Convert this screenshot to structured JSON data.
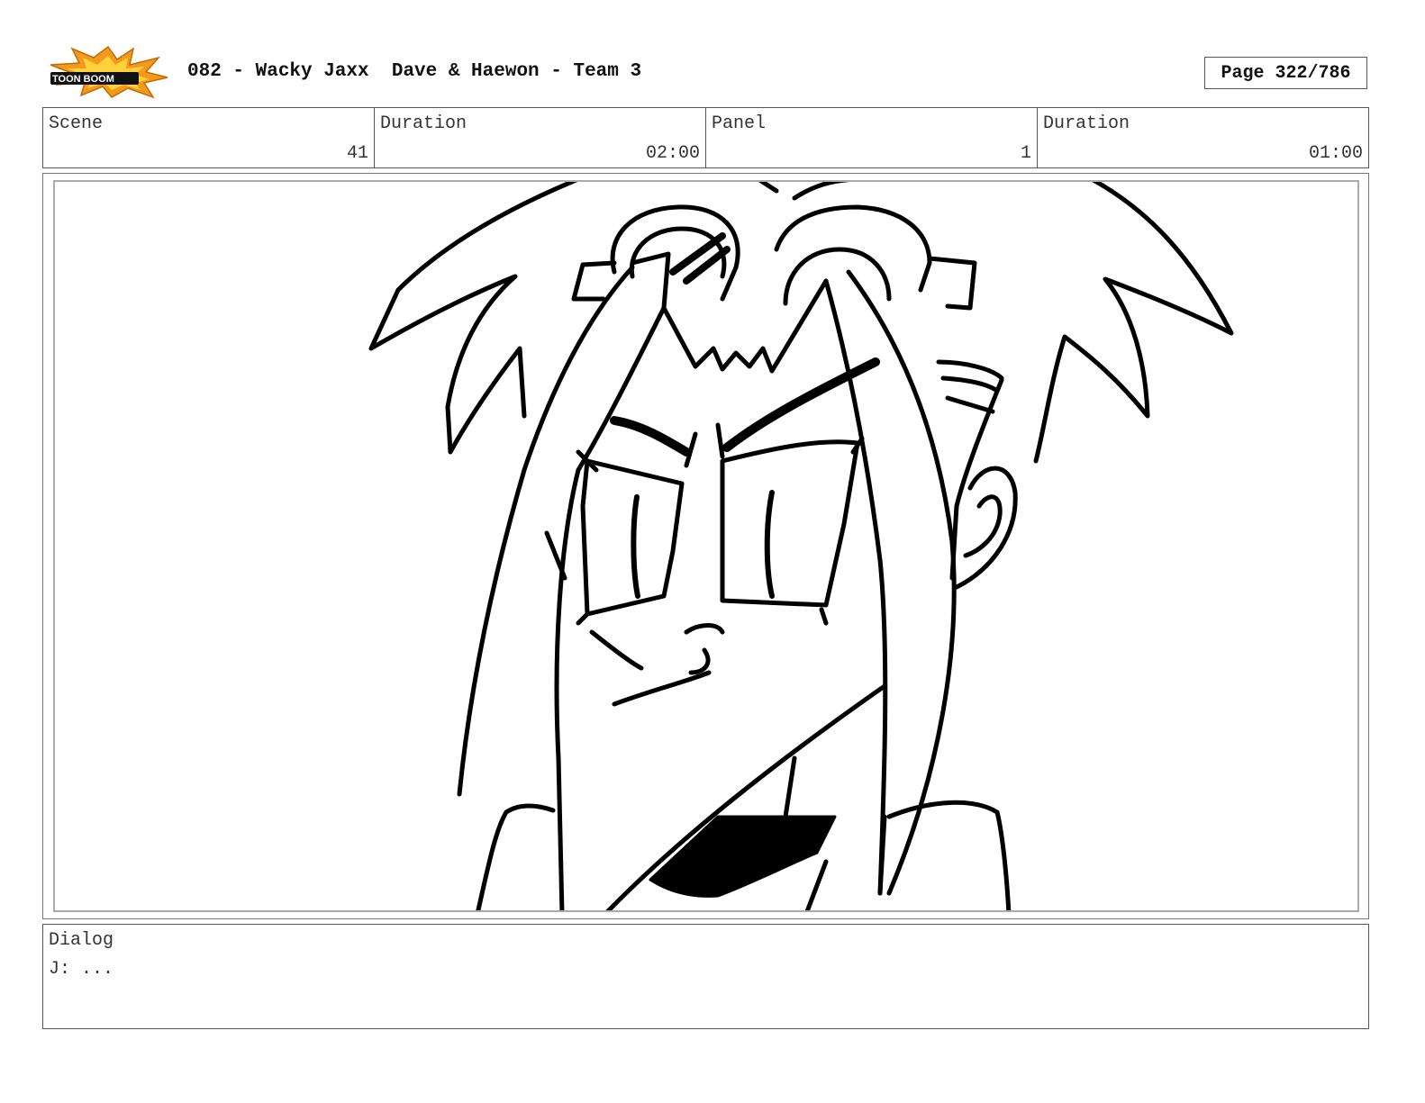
{
  "header": {
    "logo_text": "TOON BOOM",
    "title": "082 - Wacky Jaxx  Dave & Haewon - Team 3",
    "page": "Page 322/786"
  },
  "info": {
    "scene_label": "Scene",
    "scene_value": "41",
    "duration_label": "Duration",
    "duration_value": "02:00",
    "panel_label": "Panel",
    "panel_value": "1",
    "panel_duration_label": "Duration",
    "panel_duration_value": "01:00"
  },
  "dialog": {
    "label": "Dialog",
    "text": "J: ..."
  },
  "colors": {
    "logo_orange": "#f39a1e",
    "logo_yellow": "#ffd23a",
    "ink": "#000000"
  }
}
